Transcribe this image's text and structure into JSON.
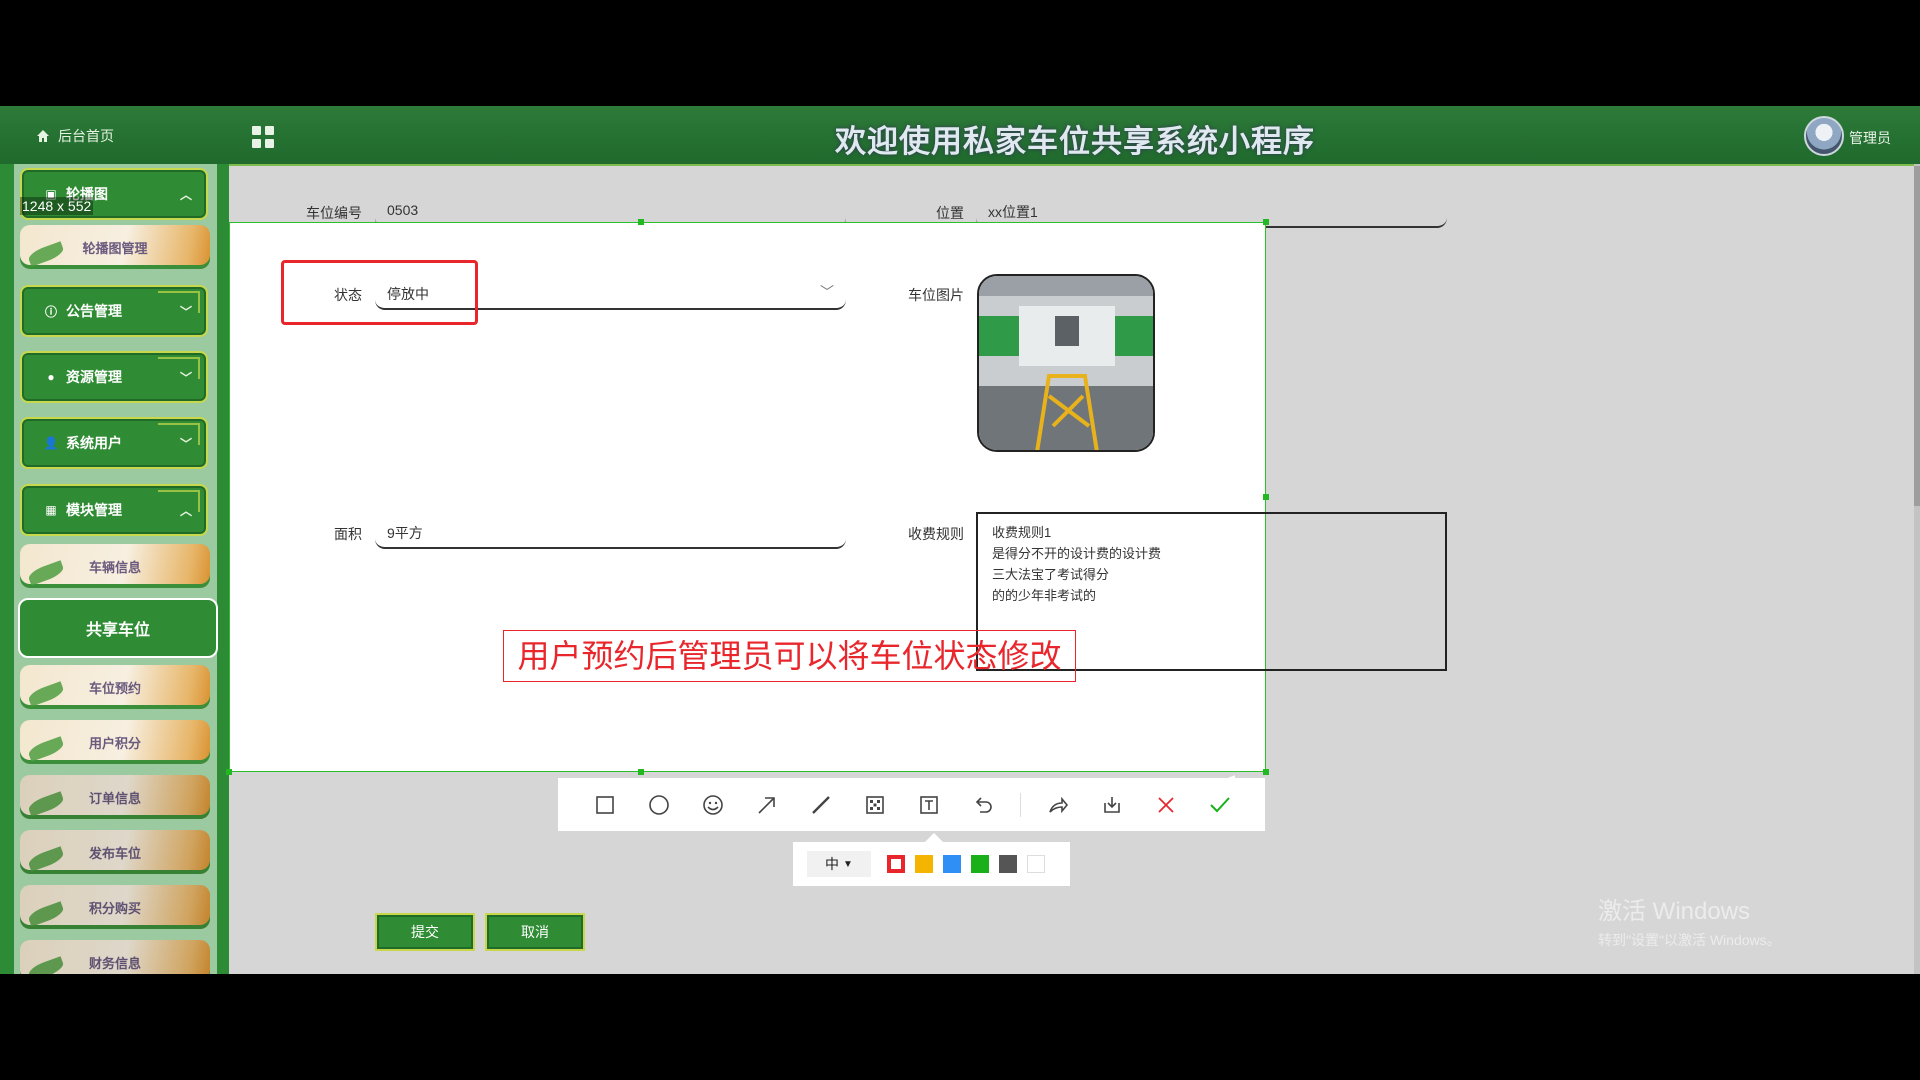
{
  "topbar": {
    "home_label": "后台首页",
    "title": "欢迎使用私家车位共享系统小程序",
    "admin_label": "管理员"
  },
  "screenshot_tool": {
    "size_readout": "1248 x 552",
    "pen_size": "中",
    "swatches": [
      "#e8262b",
      "#f5b400",
      "#2f8ff5",
      "#19b019",
      "#555555",
      "#ffffff"
    ]
  },
  "sidebar": {
    "groups": [
      {
        "label": "轮播图",
        "icon": "image-icon"
      },
      {
        "label": "公告管理",
        "icon": "info-icon"
      },
      {
        "label": "资源管理",
        "icon": "pin-icon"
      },
      {
        "label": "系统用户",
        "icon": "user-icon"
      },
      {
        "label": "模块管理",
        "icon": "modules-icon"
      }
    ],
    "items": [
      {
        "label": "轮播图管理"
      },
      {
        "label": "车辆信息"
      },
      {
        "label": "共享车位"
      },
      {
        "label": "车位预约"
      },
      {
        "label": "用户积分"
      },
      {
        "label": "订单信息"
      },
      {
        "label": "发布车位"
      },
      {
        "label": "积分购买"
      },
      {
        "label": "财务信息"
      }
    ]
  },
  "form": {
    "spot_no_label": "车位编号",
    "spot_no_value": "0503",
    "location_label": "位置",
    "location_value": "xx位置1",
    "status_label": "状态",
    "status_value": "停放中",
    "photo_label": "车位图片",
    "area_label": "面积",
    "area_value": "9平方",
    "fee_label": "收费规则",
    "fee_lines": [
      "收费规则1",
      "是得分不开的设计费的设计费",
      "三大法宝了考试得分",
      "的的少年非考试的"
    ],
    "submit_label": "提交",
    "cancel_label": "取消"
  },
  "annotation": "用户预约后管理员可以将车位状态修改",
  "watermark": {
    "line1": "激活 Windows",
    "line2": "转到\"设置\"以激活 Windows。"
  },
  "colors": {
    "theme_green": "#2f8c34",
    "annotation_red": "#e8262b",
    "selection_green": "#2bc02b"
  }
}
